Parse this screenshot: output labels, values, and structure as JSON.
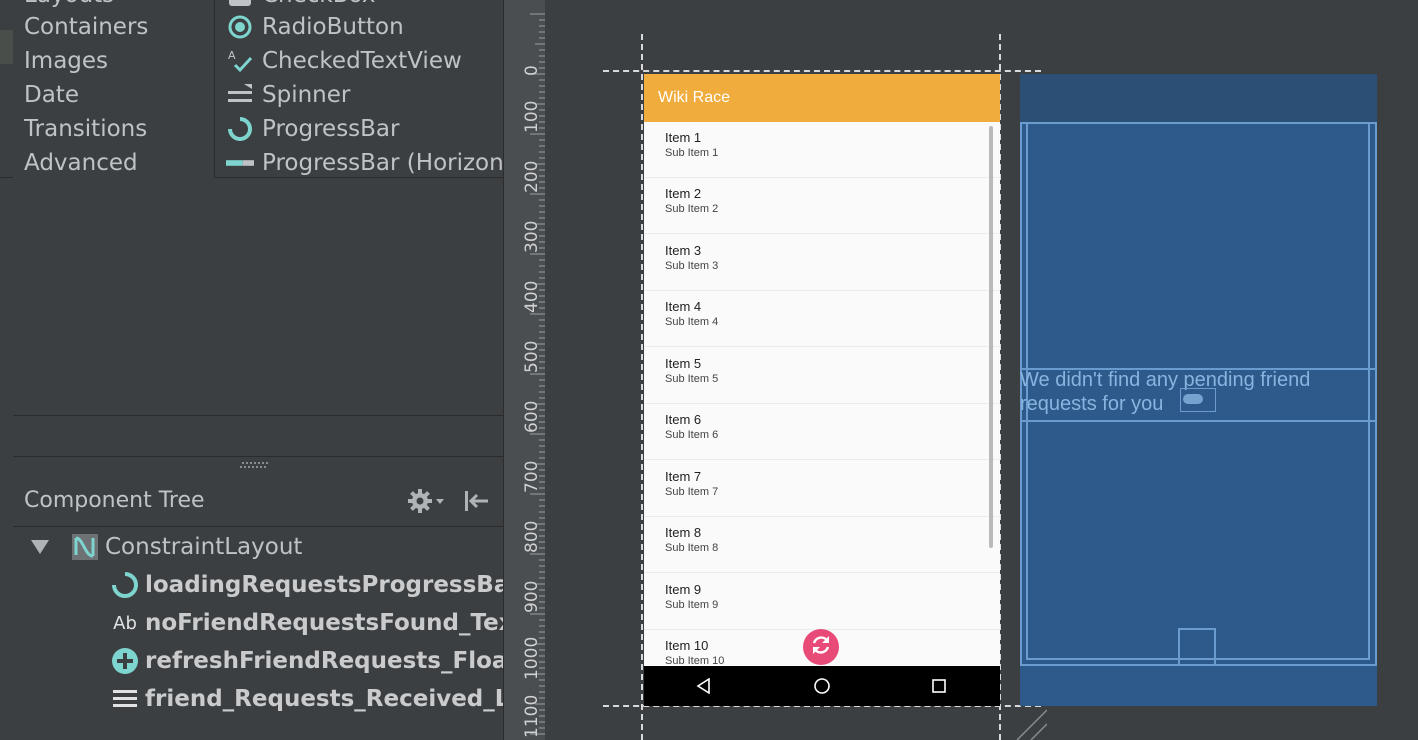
{
  "palette": {
    "categories": [
      {
        "label": "Layouts"
      },
      {
        "label": "Containers"
      },
      {
        "label": "Images"
      },
      {
        "label": "Date"
      },
      {
        "label": "Transitions"
      },
      {
        "label": "Advanced"
      }
    ],
    "widgets": [
      {
        "label": "CheckBox",
        "icon": "checkbox-icon"
      },
      {
        "label": "RadioButton",
        "icon": "radio-button-icon"
      },
      {
        "label": "CheckedTextView",
        "icon": "checked-text-view-icon"
      },
      {
        "label": "Spinner",
        "icon": "spinner-icon"
      },
      {
        "label": "ProgressBar",
        "icon": "progress-bar-icon"
      },
      {
        "label": "ProgressBar (Horizontal)",
        "icon": "progress-bar-horizontal-icon"
      }
    ]
  },
  "component_tree": {
    "title": "Component Tree",
    "root": {
      "label": "ConstraintLayout",
      "icon": "constraint-layout-icon",
      "expanded": true
    },
    "children": [
      {
        "label": "loadingRequestsProgressBar",
        "icon": "progress-bar-icon"
      },
      {
        "label": "noFriendRequestsFound_TextView",
        "icon": "text-view-icon",
        "icon_text": "Ab"
      },
      {
        "label": "refreshFriendRequests_FloatingActionButton",
        "icon": "floating-action-button-icon"
      },
      {
        "label": "friend_Requests_Received_ListView",
        "icon": "list-view-icon"
      }
    ]
  },
  "ruler": {
    "labels": [
      "0",
      "100",
      "200",
      "300",
      "400",
      "500",
      "600",
      "700",
      "800",
      "900",
      "1000",
      "1100"
    ]
  },
  "design_preview": {
    "app_title": "Wiki Race",
    "items": [
      {
        "title": "Item 1",
        "subtitle": "Sub Item 1"
      },
      {
        "title": "Item 2",
        "subtitle": "Sub Item 2"
      },
      {
        "title": "Item 3",
        "subtitle": "Sub Item 3"
      },
      {
        "title": "Item 4",
        "subtitle": "Sub Item 4"
      },
      {
        "title": "Item 5",
        "subtitle": "Sub Item 5"
      },
      {
        "title": "Item 6",
        "subtitle": "Sub Item 6"
      },
      {
        "title": "Item 7",
        "subtitle": "Sub Item 7"
      },
      {
        "title": "Item 8",
        "subtitle": "Sub Item 8"
      },
      {
        "title": "Item 9",
        "subtitle": "Sub Item 9"
      },
      {
        "title": "Item 10",
        "subtitle": "Sub Item 10"
      }
    ],
    "fab_icon": "refresh-icon",
    "nav_buttons": [
      "back-icon",
      "home-icon",
      "recents-icon"
    ]
  },
  "blueprint": {
    "message": "We didn't find any pending friend requests for you"
  },
  "colors": {
    "app_bar": "#f1ac3e",
    "fab": "#e94b78",
    "blueprint_bg": "#2d5a8a",
    "blueprint_line": "#6a9cd0",
    "icon_teal": "#7ed4cf"
  }
}
